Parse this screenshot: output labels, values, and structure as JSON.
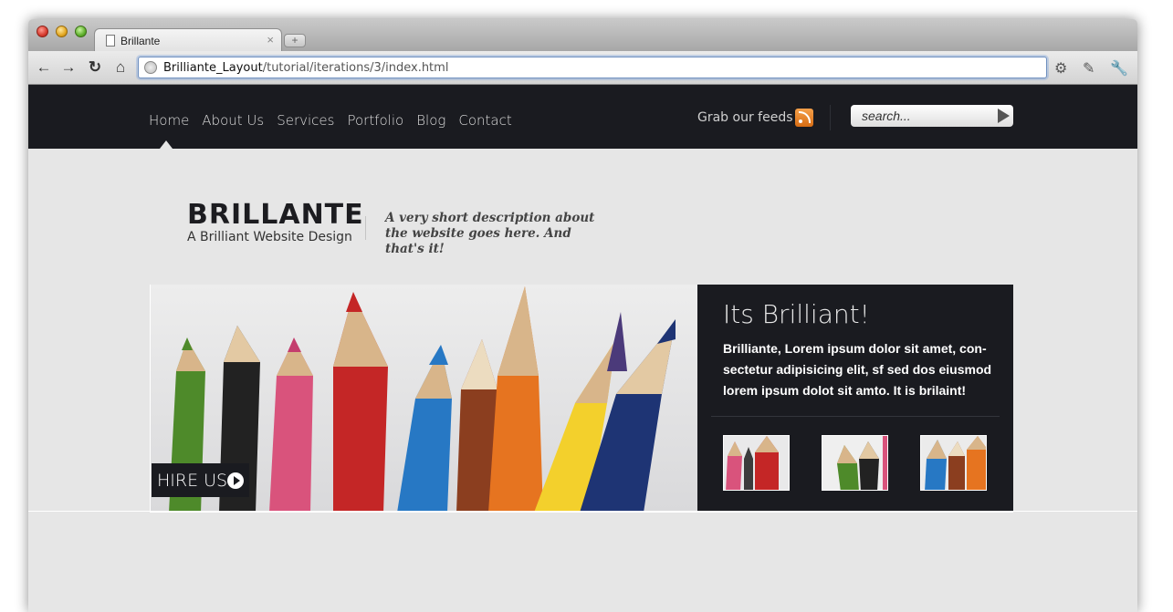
{
  "browser": {
    "tab_title": "Brillante",
    "tab_close": "×",
    "newtab_label": "+",
    "url_host": "Brilliante_Layout",
    "url_path": "/tutorial/iterations/3/index.html",
    "nav_icons": [
      "back-icon",
      "forward-icon",
      "reload-icon",
      "home-icon"
    ],
    "right_icons": [
      "settings-icon",
      "extension-icon",
      "wrench-icon"
    ]
  },
  "site": {
    "nav": [
      "Home",
      "About Us",
      "Services",
      "Portfolio",
      "Blog",
      "Contact"
    ],
    "active_nav": "Home",
    "feeds_label": "Grab our feeds",
    "search_placeholder": "search...",
    "brand_title": "BRILLANTE",
    "brand_subtitle": "A Brilliant Website Design",
    "tagline": "A very short description about the website goes here. And that's it!",
    "hire_label": "HIRE US",
    "panel_title": "Its Brilliant!",
    "panel_text": "Brilliante, Lorem ipsum dolor sit amet, con-sectetur adipisicing elit, sf sed dos eiusmod lorem ipsum dolot sit amto. It is brilaint!"
  },
  "colors": {
    "nav_bg": "#1a1b20",
    "page_bg": "#e6e6e6",
    "rss_orange": "#e07a1f"
  }
}
